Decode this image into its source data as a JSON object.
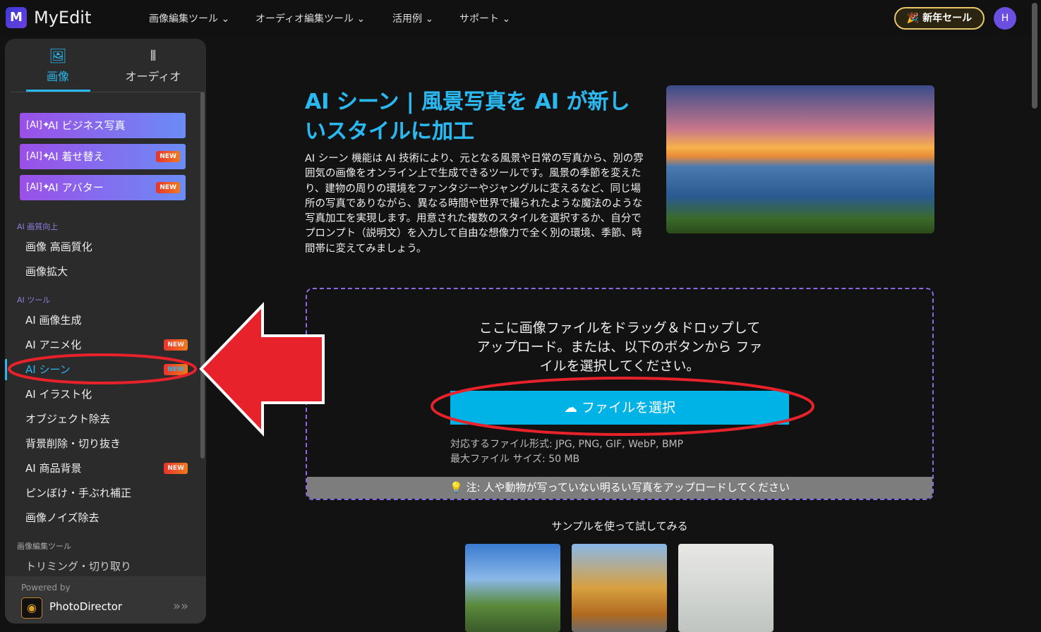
{
  "header": {
    "logo_letter": "M",
    "brand": "MyEdit",
    "nav": [
      "画像編集ツール",
      "オーディオ編集ツール",
      "活用例",
      "サポート"
    ],
    "sale": "新年セール",
    "avatar": "H"
  },
  "sidebar": {
    "tabs": [
      {
        "label": "画像",
        "icon": "image-icon"
      },
      {
        "label": "オーディオ",
        "icon": "waveform-icon"
      }
    ],
    "featured": [
      {
        "label": "AI ビジネス写真",
        "new": ""
      },
      {
        "label": "AI 着せ替え",
        "new": "NEW"
      },
      {
        "label": "AI アバター",
        "new": "NEW"
      }
    ],
    "sections": [
      {
        "title": "AI 画質向上",
        "items": [
          {
            "label": "画像 高画質化"
          },
          {
            "label": "画像拡大"
          }
        ]
      },
      {
        "title": "AI ツール",
        "items": [
          {
            "label": "AI 画像生成"
          },
          {
            "label": "AI アニメ化",
            "new": "NEW"
          },
          {
            "label": "AI シーン",
            "new": "NEW"
          },
          {
            "label": "AI イラスト化"
          },
          {
            "label": "オブジェクト除去"
          },
          {
            "label": "背景削除・切り抜き"
          },
          {
            "label": "AI 商品背景",
            "new": "NEW"
          },
          {
            "label": "ピンぼけ・手ぶれ補正"
          },
          {
            "label": "画像ノイズ除去"
          }
        ]
      },
      {
        "title": "画像編集ツール",
        "items": [
          {
            "label": "トリミング・切り取り"
          }
        ]
      }
    ],
    "active_item": "AI シーン",
    "powered_by": "Powered by",
    "product": "PhotoDirector"
  },
  "main": {
    "title": "AI シーン | 風景写真を AI が新しいスタイルに加工",
    "description": "AI シーン 機能は AI 技術により、元となる風景や日常の写真から、別の雰囲気の画像をオンライン上で生成できるツールです。風景の季節を変えたり、建物の周りの環境をファンタジーやジャングルに変えるなど、同じ場所の写真でありながら、異なる時間や世界で撮られたような魔法のような写真加工を実現します。用意された複数のスタイルを選択するか、自分でプロンプト（説明文）を入力して自由な想像力で全く別の環境、季節、時間帯に変えてみましょう。",
    "upload": {
      "drop_text": "ここに画像ファイルをドラッグ＆ドロップしてアップロード。または、以下のボタンから ファイルを選択してください。",
      "button": "ファイルを選択",
      "formats": "対応するファイル形式: JPG, PNG, GIF, WebP, BMP",
      "max_size": "最大ファイル サイズ: 50 MB",
      "note": "注: 人や動物が写っていない明るい写真をアップロードしてください"
    },
    "samples_title": "サンプルを使って試してみる"
  },
  "colors": {
    "accent": "#2ab8f0",
    "button": "#00b3e6",
    "annotation": "#e8222a"
  }
}
